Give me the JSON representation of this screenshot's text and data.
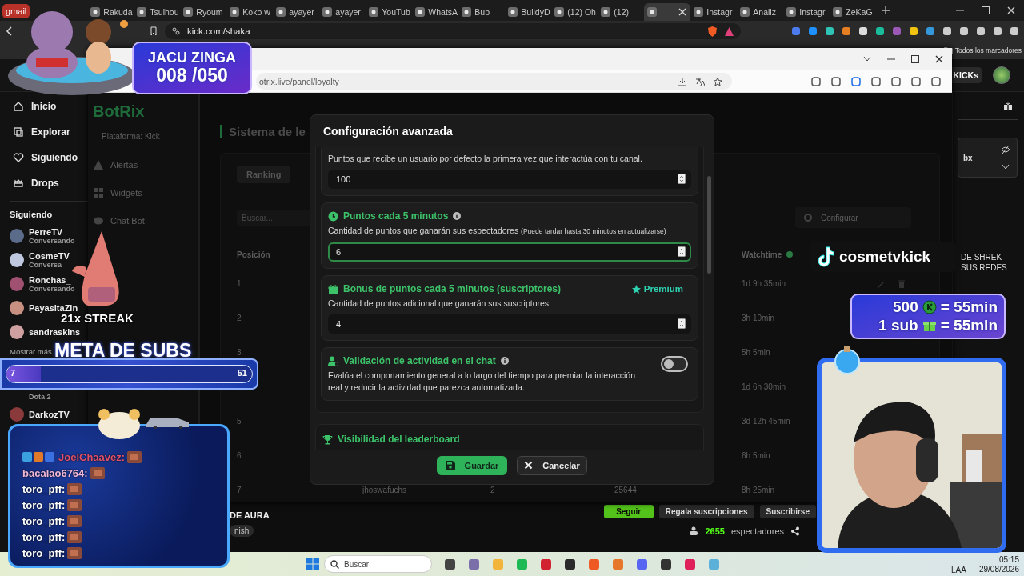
{
  "browser": {
    "tabs": [
      {
        "label": "gmail",
        "kind": "pinned",
        "selected": false
      },
      {
        "label": "Rakuda",
        "selected": false
      },
      {
        "label": "Tsuihou",
        "selected": false
      },
      {
        "label": "Ryoum",
        "selected": false
      },
      {
        "label": "Koko w",
        "selected": false
      },
      {
        "label": "ayayer",
        "selected": false
      },
      {
        "label": "ayayer",
        "selected": false
      },
      {
        "label": "YouTub",
        "selected": false
      },
      {
        "label": "WhatsA",
        "selected": false
      },
      {
        "label": "Bub",
        "selected": false
      },
      {
        "label": "BuildyD",
        "selected": false
      },
      {
        "label": "(12) Oh",
        "selected": false
      },
      {
        "label": "(12)",
        "selected": false
      },
      {
        "selected": true
      },
      {
        "label": "Instagr",
        "selected": false
      },
      {
        "label": "Analiz",
        "selected": false
      },
      {
        "label": "Instagr",
        "selected": false
      },
      {
        "label": "ZeKaG",
        "selected": false
      }
    ],
    "url": "kick.com/shaka",
    "bookmarks": "Todos los marcadores"
  },
  "kick": {
    "header_button": "KICKs",
    "nav": [
      "Inicio",
      "Explorar",
      "Siguiendo",
      "Drops"
    ],
    "following_title": "Siguiendo",
    "channels": [
      {
        "name": "PerreTV",
        "status": "Conversando"
      },
      {
        "name": "CosmeTV",
        "status": "Conversa"
      },
      {
        "name": "Ronchas_",
        "status": "Conversando"
      },
      {
        "name": "PayasitaZin"
      },
      {
        "name": "sandraskins"
      }
    ],
    "show_more": "Mostrar más",
    "more_channels": [
      {
        "status": "Dota 2"
      },
      {
        "name": "DarkozTV"
      }
    ],
    "stream": {
      "title": "DE AURA",
      "tag": "nish",
      "buttons": [
        {
          "label": "Seguir",
          "kind": "primary"
        },
        {
          "label": "Regala suscripciones",
          "kind": "secondary"
        },
        {
          "label": "Suscribirse",
          "kind": "secondary"
        }
      ],
      "viewers": "2655",
      "viewers_label": "espectadores"
    },
    "chat_panel": {
      "link": "bx",
      "lines": [
        "DE SHREK",
        "SUS REDES"
      ]
    }
  },
  "inner": {
    "url": "otrix.live/panel/loyalty"
  },
  "botrix": {
    "logo": "BotRix",
    "platform": "Plataforma: Kick",
    "menu": [
      "Alertas",
      "Widgets",
      "Chat Bot"
    ],
    "heading": "Sistema de le",
    "tab": "Ranking",
    "search_placeholder": "Buscar...",
    "dropdown": "Configurar",
    "columns": [
      "Posición",
      "Watchtime"
    ],
    "rows": [
      {
        "rank": "1",
        "watchtime": "1d 9h 35min",
        "actions": true
      },
      {
        "rank": "2",
        "watchtime": "3h 10min"
      },
      {
        "rank": "3",
        "watchtime": "5h 5min"
      },
      {
        "watchtime": "1d 6h 30min"
      },
      {
        "rank": "5",
        "watchtime": "3d 12h 45min"
      },
      {
        "rank": "6",
        "watchtime": "6h 5min"
      },
      {
        "rank": "7",
        "user": "jhoswafuchs",
        "column_3": "2",
        "column_4": "25644",
        "watchtime": "8h 25min"
      }
    ]
  },
  "modal": {
    "title": "Configuración avanzada",
    "settings": [
      {
        "kind": "number",
        "description": "Puntos que recibe un usuario por defecto la primera vez que interactúa con tu canal.",
        "value": "100",
        "focused": false
      },
      {
        "kind": "number",
        "title": "Puntos cada 5 minutos",
        "info": true,
        "description": "Cantidad de puntos que ganarán sus espectadores",
        "note": "(Puede tardar hasta 30 minutos en actualizarse)",
        "value": "6",
        "focused": true
      },
      {
        "kind": "number",
        "title": "Bonus de puntos cada 5 minutos (suscriptores)",
        "badge": "Premium",
        "description": "Cantidad de puntos adicional que ganarán sus suscriptores",
        "value": "4",
        "focused": false
      },
      {
        "kind": "toggle",
        "title": "Validación de actividad en el chat",
        "info": true,
        "description": "Evalúa el comportamiento general a lo largo del tiempo para premiar la interacción real y reducir la actividad que parezca automatizada.",
        "on": false
      }
    ],
    "next_section": "Visibilidad del leaderboard",
    "buttons": [
      {
        "label": "Guardar",
        "kind": "primary"
      },
      {
        "label": "Cancelar",
        "kind": "secondary"
      }
    ]
  },
  "overlays": {
    "jacuzzi": {
      "title": "JACU ZINGA",
      "count": "008 /050"
    },
    "streak": "21x STREAK",
    "sub_goal": {
      "title": "META DE SUBS",
      "current": "7",
      "target": "51",
      "level": 0.14
    },
    "chat": [
      {
        "user": "JoelChaavez:",
        "color": "#e0506a",
        "badges": true
      },
      {
        "user": "bacalao6764:",
        "color": "#f2b8d8"
      },
      {
        "user": "toro_pff:",
        "color": "#ffffff"
      },
      {
        "user": "toro_pff:",
        "color": "#ffffff"
      },
      {
        "user": "toro_pff:",
        "color": "#ffffff"
      },
      {
        "user": "toro_pff:",
        "color": "#ffffff"
      },
      {
        "user": "toro_pff:",
        "color": "#ffffff"
      }
    ],
    "tiktok": "cosmetvkick",
    "rates": [
      {
        "amount": "500",
        "value": "= 55min"
      },
      {
        "amount": "1 sub",
        "value": "= 55min"
      }
    ]
  },
  "taskbar": {
    "search_placeholder": "Buscar",
    "language": "LAA",
    "time": "05:15",
    "date": "29/08/2026"
  }
}
